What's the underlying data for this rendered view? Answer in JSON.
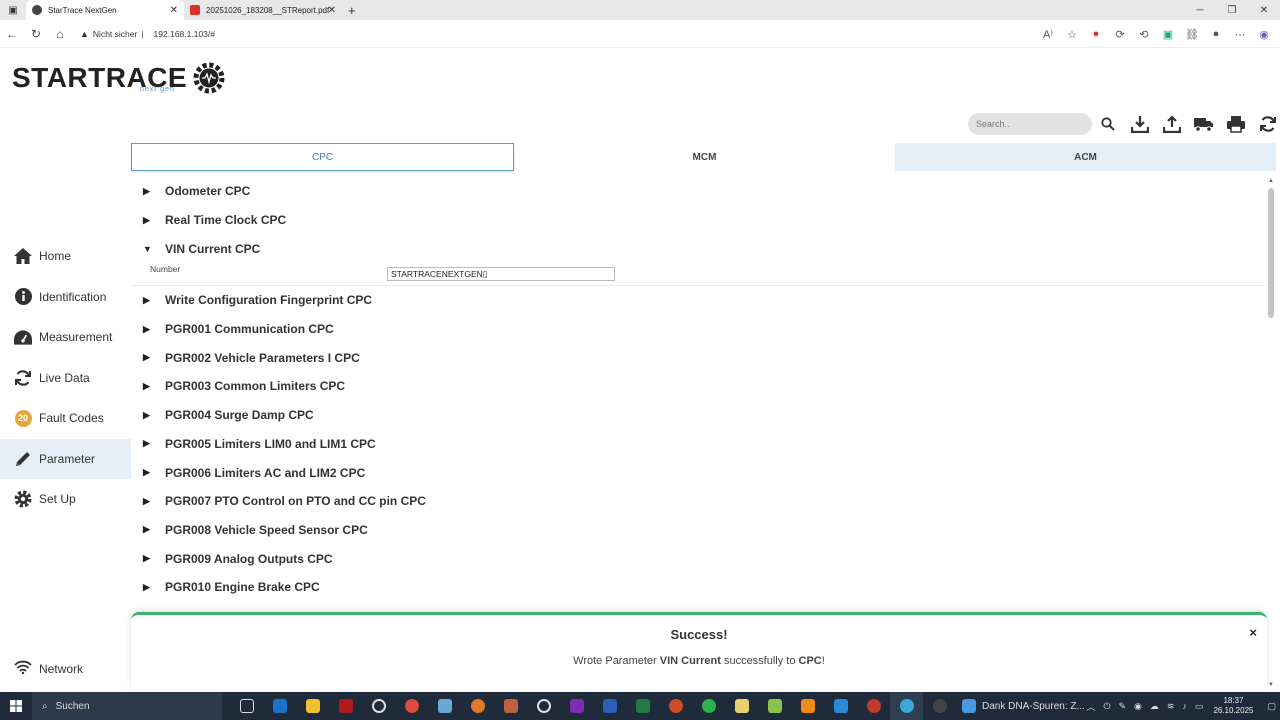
{
  "browser": {
    "tabs": [
      {
        "title": "StarTrace NextGen",
        "active": true
      },
      {
        "title": "20251026_183208__STReport.pdf",
        "active": false
      }
    ],
    "new_tab": "+",
    "security_label": "Nicht sicher",
    "url": "192.168.1.103/#"
  },
  "logo": {
    "text": "STARTRACE",
    "sub": "next gen"
  },
  "toolbar": {
    "search_placeholder": "Search..",
    "tools": [
      "search-icon",
      "download-icon",
      "upload-icon",
      "truck-icon",
      "print-icon",
      "refresh-icon"
    ]
  },
  "module_tabs": [
    {
      "label": "CPC",
      "active": true
    },
    {
      "label": "MCM",
      "active": false
    },
    {
      "label": "ACM",
      "active": false
    }
  ],
  "sidebar": {
    "items": [
      {
        "label": "Home",
        "icon": "home-icon"
      },
      {
        "label": "Identification",
        "icon": "info-icon"
      },
      {
        "label": "Measurement",
        "icon": "gauge-icon"
      },
      {
        "label": "Live Data",
        "icon": "sync-icon"
      },
      {
        "label": "Fault Codes",
        "icon": "fault-badge-icon",
        "badge": "20"
      },
      {
        "label": "Parameter",
        "icon": "pencil-icon",
        "active": true
      },
      {
        "label": "Set Up",
        "icon": "gear-icon"
      }
    ],
    "network_label": "Network"
  },
  "parameters": {
    "groups": [
      {
        "label": "Odometer CPC",
        "expanded": false
      },
      {
        "label": "Real Time Clock CPC",
        "expanded": false
      },
      {
        "label": "VIN Current CPC",
        "expanded": true
      },
      {
        "label": "Write Configuration Fingerprint CPC",
        "expanded": false
      },
      {
        "label": "PGR001 Communication CPC",
        "expanded": false
      },
      {
        "label": "PGR002 Vehicle Parameters I CPC",
        "expanded": false
      },
      {
        "label": "PGR003 Common Limiters CPC",
        "expanded": false
      },
      {
        "label": "PGR004 Surge Damp CPC",
        "expanded": false
      },
      {
        "label": "PGR005 Limiters LIM0 and LIM1 CPC",
        "expanded": false
      },
      {
        "label": "PGR006 Limiters AC and LIM2 CPC",
        "expanded": false
      },
      {
        "label": "PGR007 PTO Control on PTO and CC pin CPC",
        "expanded": false
      },
      {
        "label": "PGR008 Vehicle Speed Sensor CPC",
        "expanded": false
      },
      {
        "label": "PGR009 Analog Outputs CPC",
        "expanded": false
      },
      {
        "label": "PGR010 Engine Brake CPC",
        "expanded": false
      }
    ],
    "vin_field": {
      "label": "Number",
      "value": "STARTRACENEXTGEN▯"
    }
  },
  "toast": {
    "title": "Success!",
    "msg_prefix": "Wrote Parameter ",
    "msg_param": "VIN Current",
    "msg_mid": " successfully to ",
    "msg_target": "CPC",
    "msg_suffix": "!",
    "close": "×"
  },
  "taskbar": {
    "search_label": "Suchen",
    "news": "Dank DNA-Spuren: Z...",
    "time": "18:37",
    "date": "26.10.2025"
  },
  "colors": {
    "accent": "#3d88b2",
    "success": "#3db36b",
    "active_bg": "#e6eff7"
  }
}
